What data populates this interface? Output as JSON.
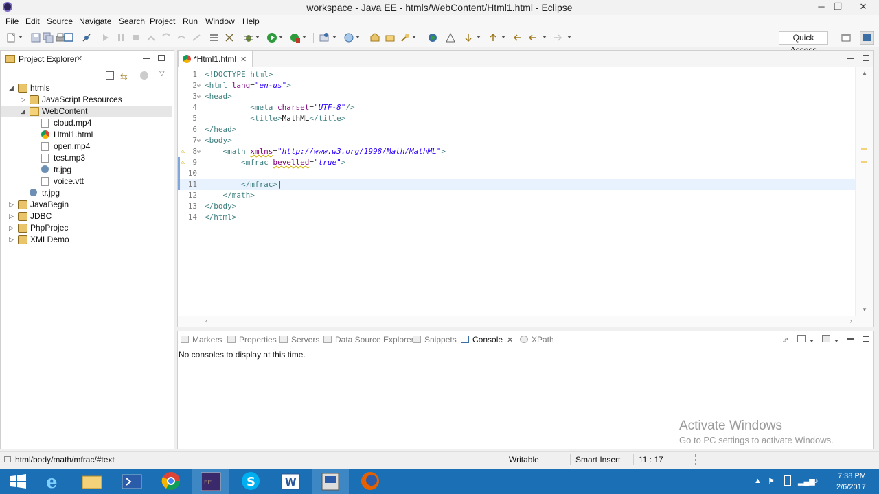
{
  "window": {
    "title": "workspace - Java EE - htmls/WebContent/Html1.html - Eclipse",
    "minimize": "─",
    "restore": "❐",
    "close": "✕"
  },
  "menu": [
    "File",
    "Edit",
    "Source",
    "Navigate",
    "Search",
    "Project",
    "Run",
    "Window",
    "Help"
  ],
  "toolbar": {
    "quick_access": "Quick Access"
  },
  "explorer": {
    "tab_label": "Project Explorer",
    "tree": [
      {
        "label": "htmls",
        "arrow": "◢",
        "icon": "project-icon"
      },
      {
        "label": "JavaScript Resources",
        "arrow": "▷",
        "icon": "js-resources-icon"
      },
      {
        "label": "WebContent",
        "arrow": "◢",
        "icon": "folder-icon"
      },
      {
        "label": "cloud.mp4",
        "arrow": "",
        "icon": "file-icon"
      },
      {
        "label": "Html1.html",
        "arrow": "",
        "icon": "chrome-file-icon"
      },
      {
        "label": "open.mp4",
        "arrow": "",
        "icon": "file-icon"
      },
      {
        "label": "test.mp3",
        "arrow": "",
        "icon": "file-icon"
      },
      {
        "label": "tr.jpg",
        "arrow": "",
        "icon": "image-icon"
      },
      {
        "label": "voice.vtt",
        "arrow": "",
        "icon": "file-icon"
      },
      {
        "label": "tr.jpg",
        "arrow": "",
        "icon": "image-icon"
      },
      {
        "label": "JavaBegin",
        "arrow": "▷",
        "icon": "project-icon"
      },
      {
        "label": "JDBC",
        "arrow": "▷",
        "icon": "project-icon"
      },
      {
        "label": "PhpProjec",
        "arrow": "▷",
        "icon": "project-icon"
      },
      {
        "label": "XMLDemo",
        "arrow": "▷",
        "icon": "project-icon"
      }
    ]
  },
  "editor": {
    "tab_label": "*Html1.html",
    "lines": [
      {
        "n": "1",
        "fold": "",
        "html": "<span class='t'>&lt;!DOCTYPE html&gt;</span>"
      },
      {
        "n": "2",
        "fold": "⊖",
        "html": "<span class='t'>&lt;html</span> <span class='a'>lang</span>=<span class='v'>\"en-us\"</span><span class='t'>&gt;</span>"
      },
      {
        "n": "3",
        "fold": "⊖",
        "html": "<span class='t'>&lt;head&gt;</span>"
      },
      {
        "n": "4",
        "fold": "",
        "html": "          <span class='t'>&lt;meta</span> <span class='a'>charset</span>=<span class='v'>\"UTF-8\"</span><span class='t'>/&gt;</span>"
      },
      {
        "n": "5",
        "fold": "",
        "html": "          <span class='t'>&lt;title&gt;</span><span class='tx'>MathML</span><span class='t'>&lt;/title&gt;</span>"
      },
      {
        "n": "6",
        "fold": "",
        "html": "<span class='t'>&lt;/head&gt;</span>"
      },
      {
        "n": "7",
        "fold": "⊖",
        "html": "<span class='t'>&lt;body&gt;</span>"
      },
      {
        "n": "8",
        "fold": "⊖",
        "html": "    <span class='t'>&lt;math</span> <span class='a warn-u'>xmlns</span>=<span class='v'>\"http://www.w3.org/1998/Math/MathML\"</span><span class='t'>&gt;</span>"
      },
      {
        "n": "9",
        "fold": "",
        "html": "        <span class='t'>&lt;mfrac</span> <span class='a warn-u'>bevelled</span>=<span class='v'>\"true\"</span><span class='t'>&gt;</span>"
      },
      {
        "n": "10",
        "fold": "",
        "html": ""
      },
      {
        "n": "11",
        "fold": "",
        "html": "        <span class='t'>&lt;/mfrac&gt;</span><span class='p'>|</span>"
      },
      {
        "n": "12",
        "fold": "",
        "html": "    <span class='t'>&lt;/math&gt;</span>"
      },
      {
        "n": "13",
        "fold": "",
        "html": "<span class='t'>&lt;/body&gt;</span>"
      },
      {
        "n": "14",
        "fold": "",
        "html": "<span class='t'>&lt;/html&gt;</span>"
      }
    ]
  },
  "console_panel": {
    "tabs": [
      "Markers",
      "Properties",
      "Servers",
      "Data Source Explorer",
      "Snippets",
      "Console",
      "XPath"
    ],
    "active_tab": "Console",
    "message": "No consoles to display at this time."
  },
  "status": {
    "path": "html/body/math/mfrac/#text",
    "writable": "Writable",
    "insert_mode": "Smart Insert",
    "position": "11 : 17"
  },
  "watermark": {
    "line1": "Activate Windows",
    "line2": "Go to PC settings to activate Windows."
  },
  "taskbar": {
    "time": "7:38 PM",
    "date": "2/6/2017"
  },
  "colors": {
    "taskbar": "#1a6fb5",
    "tag": "#3f7f7f",
    "attribute": "#7f007f",
    "value": "#2a00ff"
  }
}
